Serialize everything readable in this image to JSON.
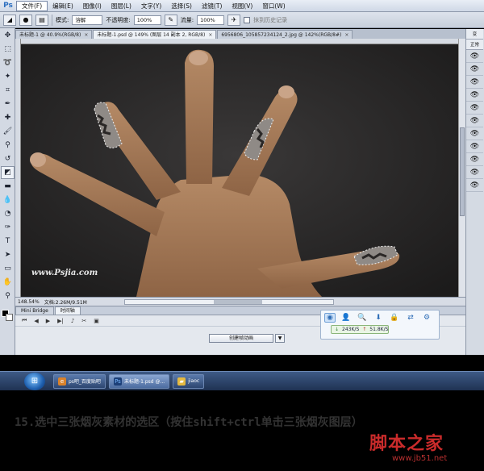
{
  "app": {
    "logo": "Ps"
  },
  "menu": [
    "文件(F)",
    "编辑(E)",
    "图像(I)",
    "图层(L)",
    "文字(Y)",
    "选择(S)",
    "滤镜(T)",
    "视图(V)",
    "窗口(W)"
  ],
  "options": {
    "mode_label": "模式:",
    "mode_value": "溶解",
    "opacity_label": "不透明度:",
    "opacity_value": "100%",
    "flow_label": "流量:",
    "flow_value": "100%",
    "history_label": "抹到历史记录"
  },
  "tabs": [
    {
      "label": "未标题-1 @ 40.9%(RGB/8)",
      "active": false
    },
    {
      "label": "未标题-1.psd @ 149% (图层 14 副本 2, RGB/8)",
      "active": true
    },
    {
      "label": "6956806_105857234124_2.jpg @ 142%(RGB/8#)",
      "active": false
    }
  ],
  "canvas": {
    "watermark": "www.Psjia.com"
  },
  "status": {
    "zoom": "148.54%",
    "doc": "文档:2.26M/9.51M"
  },
  "timeline": {
    "tabs": [
      "Mini Bridge",
      "时间轴"
    ],
    "create_button": "创建帧动画"
  },
  "widget": {
    "down_speed": "243K/S",
    "up_speed": "51.8K/S"
  },
  "taskbar": {
    "items": [
      {
        "label": "ps吧_百度贴吧",
        "active": false
      },
      {
        "label": "未标题-1.psd @...",
        "active": true
      },
      {
        "label": "jiaoc",
        "active": false
      }
    ]
  },
  "panel": {
    "tab1": "变",
    "tab2": "正常"
  },
  "caption": "15.选中三张烟灰素材的选区（按住shift+ctrl单击三张烟灰图层）",
  "brand": {
    "logo_text": "脚本之家",
    "url": "www.jb51.net"
  },
  "colors": {
    "canvas_bg": "#2c2b2b",
    "skin": "#a97d59",
    "brand": "#ca2b2b"
  }
}
